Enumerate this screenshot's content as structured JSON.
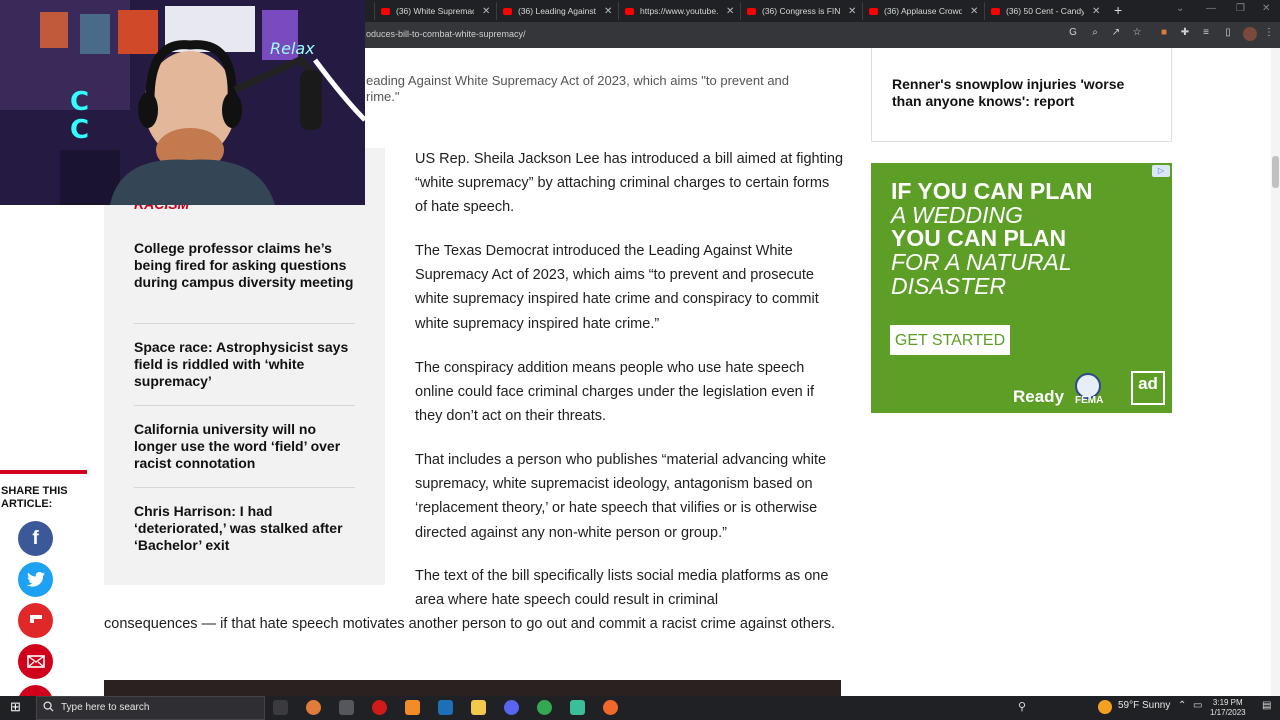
{
  "browser": {
    "tabs": [
      {
        "title": "(36) White Supremacy"
      },
      {
        "title": "(36) Leading Against"
      },
      {
        "title": "https://www.youtube..."
      },
      {
        "title": "(36) Congress is FINA..."
      },
      {
        "title": "(36) Applause Crowd"
      },
      {
        "title": "(36) 50 Cent - Candy"
      }
    ],
    "new_tab": "+",
    "url": "oduces-bill-to-combat-white-supremacy/"
  },
  "article": {
    "caption": "eading Against White Supremacy Act of 2023, which aims \"to prevent and rime.\"",
    "paragraphs": [
      "US Rep. Sheila Jackson Lee has introduced a bill aimed at fighting “white supremacy” by attaching criminal charges to certain forms of hate speech.",
      "The Texas Democrat introduced the Leading Against White Supremacy Act of 2023, which aims “to prevent and prosecute white supremacy inspired hate crime and conspiracy to commit white supremacy inspired hate crime.”",
      "The conspiracy addition means people who use hate speech online could face criminal charges under the legislation even if they don’t act on their threats.",
      "That includes a person who publishes “material advancing white supremacy, white supremacist ideology, antagonism based on ‘replacement theory,’ or hate speech that vilifies or is otherwise directed against any non-white person or group.”"
    ],
    "para5_line1": "The text of the bill specifically lists social media platforms as one area where hate speech could result in criminal",
    "para5_line2": "consequences — if that hate speech motivates another person to go out and commit a racist crime against others."
  },
  "sidebar": {
    "partial_title": "RACISM",
    "items": [
      {
        "title": "College professor claims he’s being fired for asking questions during campus diversity meeting"
      },
      {
        "title": "Space race: Astrophysicist says field is riddled with ‘white supremacy’"
      },
      {
        "title": "California university will no longer use the word ‘field’ over racist connotation"
      },
      {
        "title": "Chris Harrison: I had ‘deteriorated,’ was stalked after ‘Bachelor’ exit"
      }
    ]
  },
  "share": {
    "label": "SHARE THIS ARTICLE:",
    "buttons": [
      "facebook-icon",
      "twitter-icon",
      "flipboard-icon",
      "email-icon"
    ]
  },
  "right_rail": {
    "trending_title": "Renner's snowplow injuries 'worse than anyone knows': report"
  },
  "ad": {
    "line1": "IF YOU CAN PLAN",
    "line2": "A WEDDING",
    "line3": "YOU CAN PLAN",
    "line4": "FOR A NATURAL",
    "line5": "DISASTER",
    "cta": "GET STARTED",
    "logo_ready": "Ready",
    "logo_fema": "FEMA",
    "logo_ad": "ad",
    "bg_color": "#5d9e26"
  },
  "taskbar": {
    "search_placeholder": "Type here to search",
    "weather": "59°F  Sunny",
    "time": "3:19 PM",
    "date": "1/17/2023"
  }
}
